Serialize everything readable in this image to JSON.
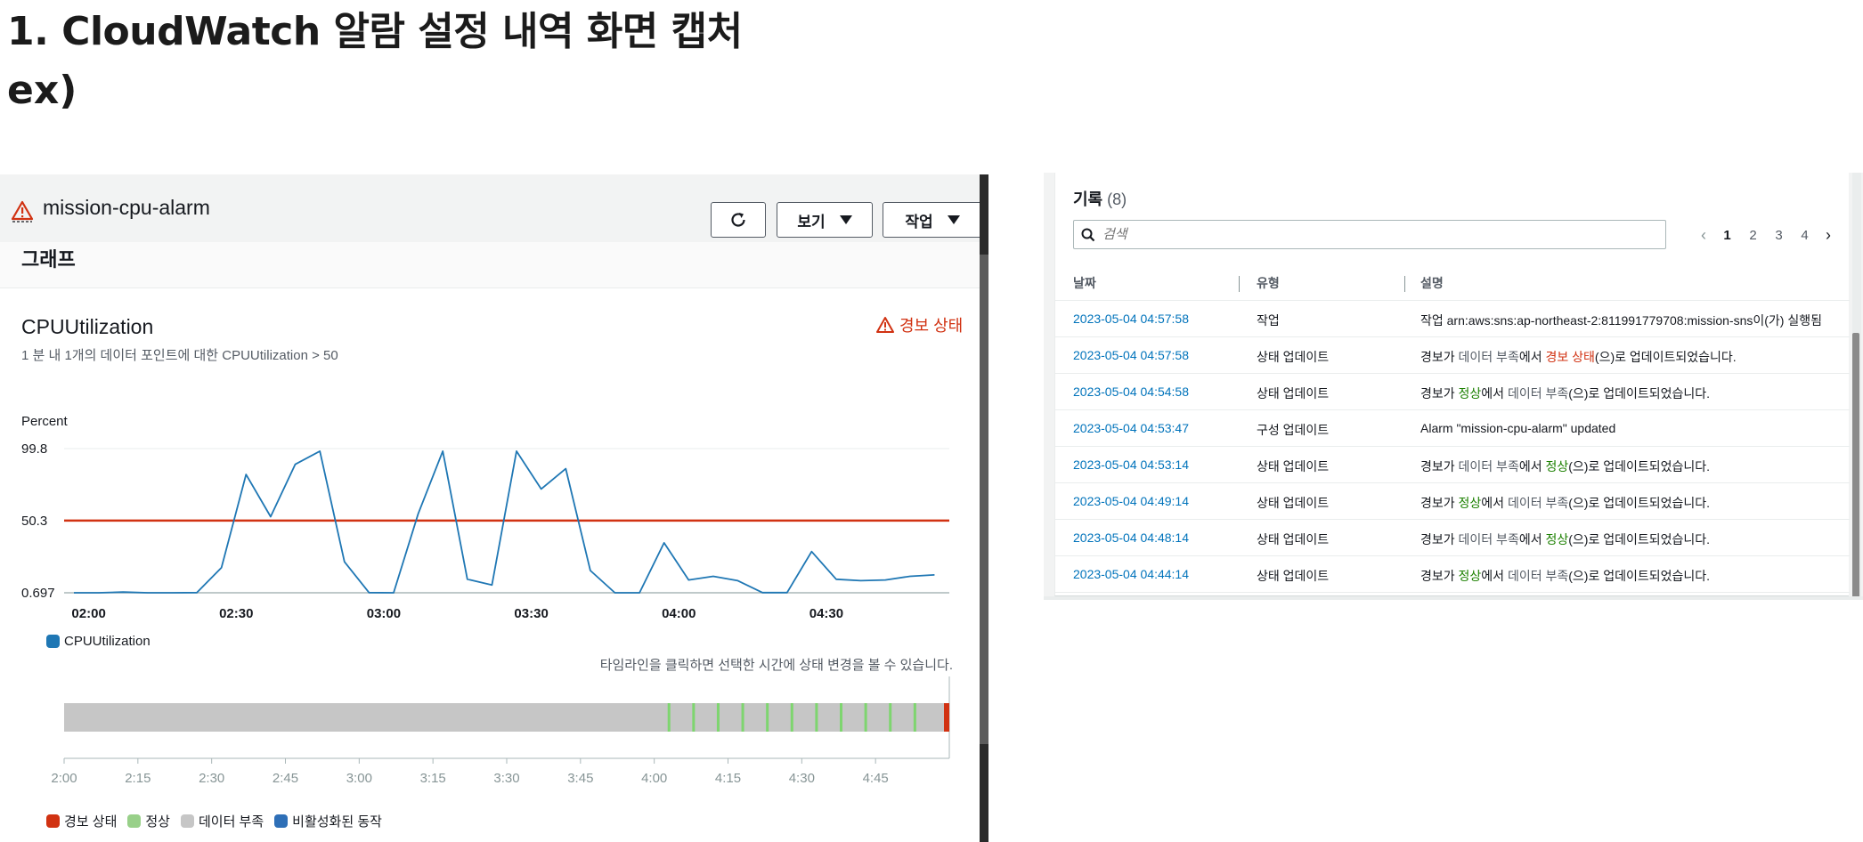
{
  "doc": {
    "title": "1. CloudWatch 알람 설정 내역 화면 캡처",
    "subtitle": "ex)"
  },
  "alarm": {
    "name": "mission-cpu-alarm",
    "buttons": {
      "view": "보기",
      "action": "작업"
    },
    "section_title": "그래프",
    "metric_name": "CPUUtilization",
    "metric_desc": "1 분 내 1개의 데이터 포인트에 대한 CPUUtilization > 50",
    "state_label": "경보 상태",
    "timeline_note": "타임라인을 클릭하면 선택한 시간에 상태 변경을 볼 수 있습니다."
  },
  "chart_data": {
    "type": "line",
    "ylabel": "Percent",
    "y_ticks": [
      "99.8",
      "50.3",
      "0.697"
    ],
    "ylim": [
      0.697,
      99.8
    ],
    "x_ticks": [
      "02:00",
      "02:30",
      "03:00",
      "03:30",
      "04:00",
      "04:30"
    ],
    "threshold": 50.3,
    "series": [
      {
        "name": "CPUUtilization",
        "color": "#1f77b4",
        "x": [
          "01:57",
          "02:02",
          "02:07",
          "02:12",
          "02:17",
          "02:22",
          "02:27",
          "02:32",
          "02:37",
          "02:42",
          "02:47",
          "02:52",
          "02:57",
          "03:02",
          "03:07",
          "03:12",
          "03:17",
          "03:22",
          "03:27",
          "03:32",
          "03:37",
          "03:42",
          "03:47",
          "03:52",
          "03:57",
          "04:02",
          "04:07",
          "04:12",
          "04:17",
          "04:22",
          "04:27",
          "04:32",
          "04:37",
          "04:42",
          "04:47",
          "04:52"
        ],
        "values": [
          0.7,
          0.7,
          1.2,
          0.7,
          0.7,
          0.8,
          18,
          82,
          53,
          89,
          98,
          22,
          0.8,
          0.7,
          55,
          98,
          10,
          6,
          98,
          72,
          86,
          16,
          0.7,
          0.7,
          35,
          9.5,
          12,
          9,
          0.8,
          0.8,
          29,
          10,
          9,
          9.5,
          12,
          13
        ]
      }
    ],
    "legend": [
      "CPUUtilization"
    ]
  },
  "timeline": {
    "x_ticks": [
      "2:00",
      "2:15",
      "2:30",
      "2:45",
      "3:00",
      "3:15",
      "3:30",
      "3:45",
      "4:00",
      "4:15",
      "4:30",
      "4:45"
    ],
    "ok_marks": [
      "04:03",
      "04:08",
      "04:13",
      "04:18",
      "04:23",
      "04:28",
      "04:33",
      "04:38",
      "04:43",
      "04:48",
      "04:53"
    ],
    "legend": [
      {
        "label": "경보 상태",
        "color": "#d13212"
      },
      {
        "label": "정상",
        "color": "#98d089"
      },
      {
        "label": "데이터 부족",
        "color": "#c6c6c6"
      },
      {
        "label": "비활성화된 동작",
        "color": "#2e6fb7"
      }
    ]
  },
  "history": {
    "title": "기록",
    "count": "(8)",
    "search_placeholder": "검색",
    "pages": [
      "1",
      "2",
      "3",
      "4"
    ],
    "columns": [
      "날짜",
      "유형",
      "설명"
    ],
    "rows": [
      {
        "date": "2023-05-04 04:57:58",
        "type": "작업",
        "desc": [
          {
            "t": "작업 arn:aws:sns:ap-northeast-2:811991779708:mission-sns이(가) 실행됨",
            "c": ""
          }
        ]
      },
      {
        "date": "2023-05-04 04:57:58",
        "type": "상태 업데이트",
        "desc": [
          {
            "t": "경보가 ",
            "c": ""
          },
          {
            "t": "데이터 부족",
            "c": "st-insuf"
          },
          {
            "t": "에서 ",
            "c": ""
          },
          {
            "t": "경보 상태",
            "c": "st-alarm"
          },
          {
            "t": "(으)로 업데이트되었습니다.",
            "c": ""
          }
        ]
      },
      {
        "date": "2023-05-04 04:54:58",
        "type": "상태 업데이트",
        "desc": [
          {
            "t": "경보가 ",
            "c": ""
          },
          {
            "t": "정상",
            "c": "st-ok"
          },
          {
            "t": "에서 ",
            "c": ""
          },
          {
            "t": "데이터 부족",
            "c": "st-insuf"
          },
          {
            "t": "(으)로 업데이트되었습니다.",
            "c": ""
          }
        ]
      },
      {
        "date": "2023-05-04 04:53:47",
        "type": "구성 업데이트",
        "desc": [
          {
            "t": "Alarm \"mission-cpu-alarm\" updated",
            "c": ""
          }
        ]
      },
      {
        "date": "2023-05-04 04:53:14",
        "type": "상태 업데이트",
        "desc": [
          {
            "t": "경보가 ",
            "c": ""
          },
          {
            "t": "데이터 부족",
            "c": "st-insuf"
          },
          {
            "t": "에서 ",
            "c": ""
          },
          {
            "t": "정상",
            "c": "st-ok"
          },
          {
            "t": "(으)로 업데이트되었습니다.",
            "c": ""
          }
        ]
      },
      {
        "date": "2023-05-04 04:49:14",
        "type": "상태 업데이트",
        "desc": [
          {
            "t": "경보가 ",
            "c": ""
          },
          {
            "t": "정상",
            "c": "st-ok"
          },
          {
            "t": "에서 ",
            "c": ""
          },
          {
            "t": "데이터 부족",
            "c": "st-insuf"
          },
          {
            "t": "(으)로 업데이트되었습니다.",
            "c": ""
          }
        ]
      },
      {
        "date": "2023-05-04 04:48:14",
        "type": "상태 업데이트",
        "desc": [
          {
            "t": "경보가 ",
            "c": ""
          },
          {
            "t": "데이터 부족",
            "c": "st-insuf"
          },
          {
            "t": "에서 ",
            "c": ""
          },
          {
            "t": "정상",
            "c": "st-ok"
          },
          {
            "t": "(으)로 업데이트되었습니다.",
            "c": ""
          }
        ]
      },
      {
        "date": "2023-05-04 04:44:14",
        "type": "상태 업데이트",
        "desc": [
          {
            "t": "경보가 ",
            "c": ""
          },
          {
            "t": "정상",
            "c": "st-ok"
          },
          {
            "t": "에서 ",
            "c": ""
          },
          {
            "t": "데이터 부족",
            "c": "st-insuf"
          },
          {
            "t": "(으)로 업데이트되었습니다.",
            "c": ""
          }
        ]
      }
    ]
  },
  "colors": {
    "alarm": "#d13212",
    "ok": "#1d8102",
    "link": "#0073bb",
    "line": "#1f77b4"
  }
}
